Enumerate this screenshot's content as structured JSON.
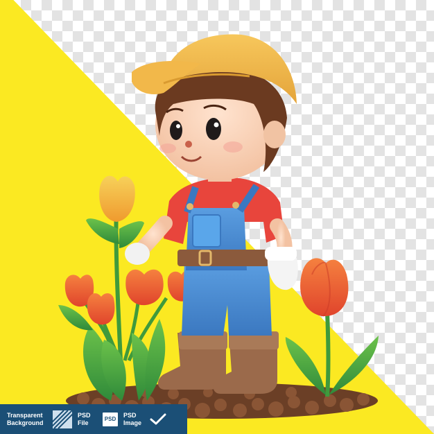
{
  "colors": {
    "background_yellow": "#fbe922",
    "badge_bar": "#1b4f76",
    "cap": "#f2b84a",
    "shirt": "#e8453c",
    "overalls": "#4a90d9",
    "boots": "#9b6a4b",
    "tulip_orange": "#f2673a",
    "tulip_yellow": "#f4b73a",
    "leaf_green": "#4caf50",
    "soil": "#7a4a2e"
  },
  "badge": {
    "item1_line1": "Transparent",
    "item1_line2": "Background",
    "item2_line1": "PSD",
    "item2_line2": "File",
    "psd_box_label": "PSD",
    "item3_line1": "PSD",
    "item3_line2": "Image"
  },
  "icons": {
    "transparency": "diagonal-stripes-icon",
    "psd": "psd-file-icon",
    "check": "checkmark-icon"
  }
}
